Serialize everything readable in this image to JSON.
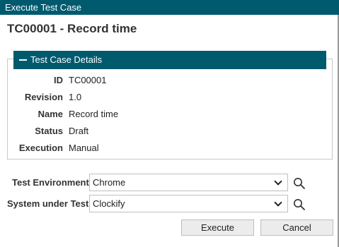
{
  "window": {
    "title": "Execute Test Case"
  },
  "case_title": "TC00001 - Record time",
  "details": {
    "header": "Test Case Details",
    "fields": [
      {
        "label": "ID",
        "value": "TC00001"
      },
      {
        "label": "Revision",
        "value": "1.0"
      },
      {
        "label": "Name",
        "value": "Record time"
      },
      {
        "label": "Status",
        "value": "Draft"
      },
      {
        "label": "Execution",
        "value": "Manual"
      }
    ]
  },
  "form": {
    "environment": {
      "label": "Test Environment",
      "value": "Chrome"
    },
    "system": {
      "label": "System under Test",
      "value": "Clockify"
    }
  },
  "actions": {
    "execute": "Execute",
    "cancel": "Cancel"
  },
  "colors": {
    "accent": "#005a6e"
  }
}
